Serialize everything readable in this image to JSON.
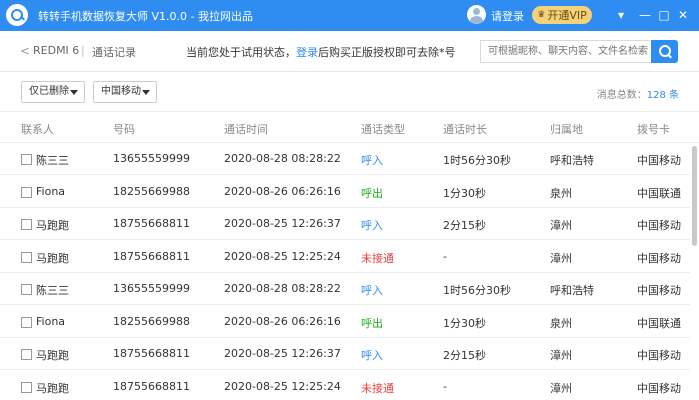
{
  "app": {
    "title": "转转手机数据恢复大师 V1.0.0 - 我拉网出品",
    "login_label": "请登录",
    "vip_label": "开通VIP",
    "window_buttons": [
      "▾",
      "—",
      "□",
      "✕"
    ]
  },
  "toolbar": {
    "back": "<",
    "device": "REDMI 6",
    "separator": "|",
    "section": "通话记录",
    "notice_prefix": "当前您处于试用状态，",
    "notice_link": "登录",
    "notice_suffix": "后购买正版授权即可去除*号",
    "search_placeholder": "可根据昵称、聊天内容、文件名检索"
  },
  "filters": {
    "deleted_filter": "仅已删除",
    "carrier_filter": "中国移动"
  },
  "summary": {
    "total_label": "消息总数：",
    "total_count": "128",
    "total_unit": " 条"
  },
  "table": {
    "headers": [
      "联系人",
      "号码",
      "通话时间",
      "通话类型",
      "通话时长",
      "归属地",
      "拨号卡"
    ],
    "rows": [
      {
        "contact": "陈三三",
        "number": "13655559999",
        "time": "2020-08-28 08:28:22",
        "type": "呼入",
        "type_kind": "in",
        "duration": "1时56分30秒",
        "location": "呼和浩特",
        "card": "中国移动"
      },
      {
        "contact": "Fiona",
        "number": "18255669988",
        "time": "2020-08-26 06:26:16",
        "type": "呼出",
        "type_kind": "out",
        "duration": "1分30秒",
        "location": "泉州",
        "card": "中国联通"
      },
      {
        "contact": "马跑跑",
        "number": "18755668811",
        "time": "2020-08-25 12:26:37",
        "type": "呼入",
        "type_kind": "in",
        "duration": "2分15秒",
        "location": "漳州",
        "card": "中国移动"
      },
      {
        "contact": "马跑跑",
        "number": "18755668811",
        "time": "2020-08-25 12:25:24",
        "type": "未接通",
        "type_kind": "miss",
        "duration": "-",
        "location": "漳州",
        "card": "中国移动"
      },
      {
        "contact": "陈三三",
        "number": "13655559999",
        "time": "2020-08-28 08:28:22",
        "type": "呼入",
        "type_kind": "in",
        "duration": "1时56分30秒",
        "location": "呼和浩特",
        "card": "中国移动"
      },
      {
        "contact": "Fiona",
        "number": "18255669988",
        "time": "2020-08-26 06:26:16",
        "type": "呼出",
        "type_kind": "out",
        "duration": "1分30秒",
        "location": "泉州",
        "card": "中国联通"
      },
      {
        "contact": "马跑跑",
        "number": "18755668811",
        "time": "2020-08-25 12:26:37",
        "type": "呼入",
        "type_kind": "in",
        "duration": "2分15秒",
        "location": "漳州",
        "card": "中国移动"
      },
      {
        "contact": "马跑跑",
        "number": "18755668811",
        "time": "2020-08-25 12:25:24",
        "type": "未接通",
        "type_kind": "miss",
        "duration": "-",
        "location": "漳州",
        "card": "中国移动"
      }
    ]
  },
  "colors": {
    "accent": "#2f8cf0",
    "vip": "#f5d27a",
    "call_in": "#2f8cf0",
    "call_out": "#1aad19",
    "call_missed": "#e64340"
  }
}
